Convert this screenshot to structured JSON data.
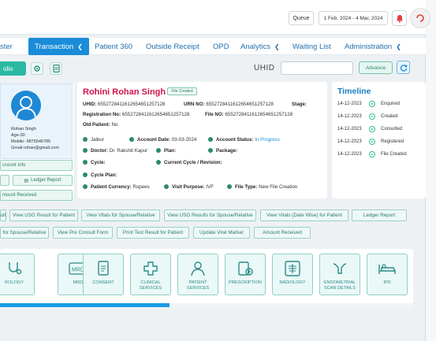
{
  "header": {
    "queue_label": "Queue",
    "date_range": "1 Feb, 2024 - 4 Mar, 2024"
  },
  "nav": {
    "items": [
      "ster",
      "Transaction",
      "Patient 360",
      "Outside Receipt",
      "OPD",
      "Analytics",
      "Waiting List",
      "Administration"
    ],
    "active_index": 1
  },
  "toolbar": {
    "folio_label": "olio",
    "uhid_label": "UHID",
    "uhid_value": "",
    "advance_label": "Advance"
  },
  "patient_side": {
    "name": "Rohan Singh",
    "age": "Age-30",
    "mobile": "Mobile- 9876546785",
    "email": "Gmail-rohan@gmail.com",
    "buttons": [
      "ccount Info",
      "Ledger Report",
      "mount Received"
    ]
  },
  "patient_card": {
    "name": "Rohini Rohan Singh",
    "badge": "File Created",
    "uhid_label": "UHID:",
    "uhid_value": "6552728411612654651257128",
    "urn_label": "URN NO:",
    "urn_value": "6552728411612654651257128",
    "stage_label": "Stage:",
    "reg_label": "Registration No:",
    "reg_value": "6552728411612654651257128",
    "file_label": "File NO:",
    "file_value": "6552728411612654651257128",
    "old_patient_label": "Old Patient:",
    "old_patient_value": "No",
    "city": "Jaibur",
    "account_date_label": "Account Date:",
    "account_date_value": "03-03-2024",
    "account_status_label": "Account Status:",
    "account_status_value": "In Progress",
    "doctor_label": "Doctor:",
    "doctor_value": "Dr. Rakshit Kapur",
    "plan_label": "Plan:",
    "package_label": "Package:",
    "cycle_label": "Cycle:",
    "current_cycle_label": "Current Cycle / Revision:",
    "cycle_plan_label": "Cycle Plan:",
    "currency_label": "Patient Currency:",
    "currency_value": "Rupees",
    "visit_label": "Visit Purpose:",
    "visit_value": "IVF",
    "filetype_label": "File Type:",
    "filetype_value": "New File Creation"
  },
  "timeline": {
    "title": "Timeline",
    "events": [
      {
        "date": "14-12-2023",
        "status": "Enquired"
      },
      {
        "date": "14-12-2023",
        "status": "Created"
      },
      {
        "date": "14-12-2023",
        "status": "Consulted"
      },
      {
        "date": "14-12-2023",
        "status": "Registered"
      },
      {
        "date": "14-12-2023",
        "status": "File Created"
      }
    ]
  },
  "actions": {
    "row1": [
      "ult",
      "View USG Result for Patient",
      "View Vitals for Spouse/Relative",
      "View USG Results for Spouse/Relative",
      "View Vitals (Date Wise) for Patient",
      "Ledger Report"
    ],
    "row2": [
      "for Spouse/Relative",
      "View Pre Consult Form",
      "Print Test Result for Patient",
      "Update Viral Marker",
      "Amount Received"
    ]
  },
  "modules": [
    {
      "label": "ROLOGY",
      "icon": "stethoscope-icon"
    },
    {
      "label": "MRD",
      "icon": "mrd-icon"
    },
    {
      "label": "CONSENT",
      "icon": "consent-icon"
    },
    {
      "label": "CLINICAL SERVICES",
      "icon": "clinical-services-icon"
    },
    {
      "label": "PATIENT SERVICES",
      "icon": "patient-services-icon"
    },
    {
      "label": "PRESCRIPTION",
      "icon": "prescription-icon"
    },
    {
      "label": "RADIOLOGY",
      "icon": "radiology-icon"
    },
    {
      "label": "ENDOMETRIAL SCAN DETAILS",
      "icon": "endometrial-icon"
    },
    {
      "label": "IPD",
      "icon": "bed-icon"
    }
  ],
  "scroll_progress": 0.41,
  "colors": {
    "accent": "#1a8cd8",
    "teal": "#2bb9a3",
    "name": "#d0154e"
  }
}
